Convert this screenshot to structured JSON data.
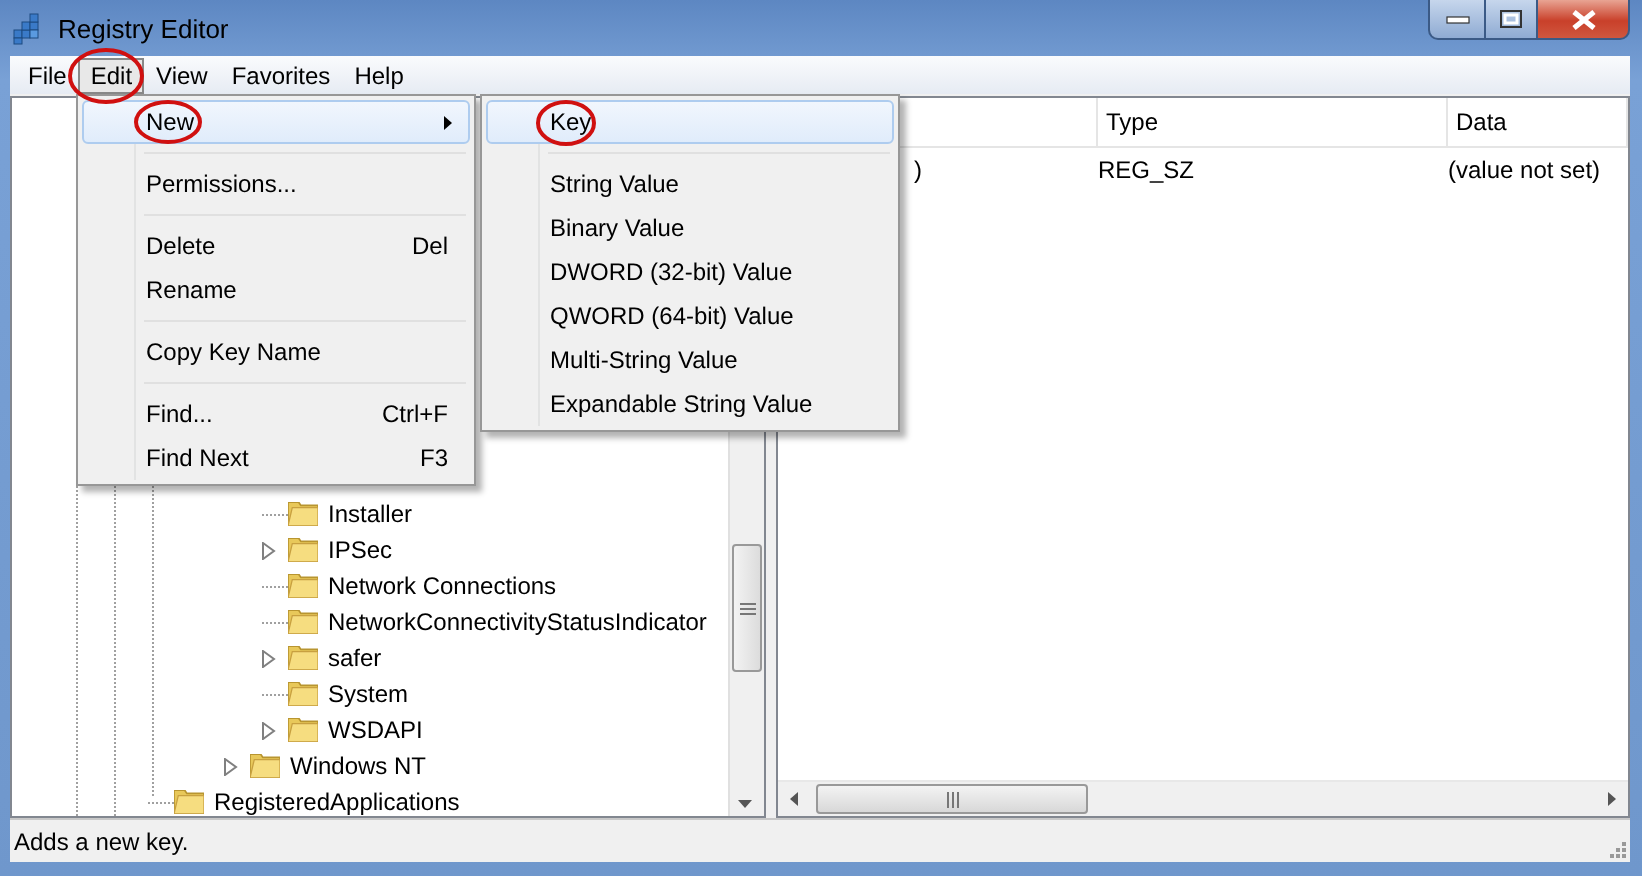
{
  "window": {
    "title": "Registry Editor"
  },
  "menu_bar": [
    {
      "label": "File",
      "selected": false,
      "circled": false
    },
    {
      "label": "Edit",
      "selected": true,
      "circled": true
    },
    {
      "label": "View",
      "selected": false,
      "circled": false
    },
    {
      "label": "Favorites",
      "selected": false,
      "circled": false
    },
    {
      "label": "Help",
      "selected": false,
      "circled": false
    }
  ],
  "edit_menu": [
    {
      "kind": "item",
      "label": "New",
      "submenu": true,
      "selected": true,
      "circled": true
    },
    {
      "kind": "separator"
    },
    {
      "kind": "item",
      "label": "Permissions...",
      "submenu": false,
      "selected": false,
      "circled": false
    },
    {
      "kind": "separator"
    },
    {
      "kind": "item",
      "label": "Delete",
      "shortcut": "Del",
      "submenu": false,
      "selected": false,
      "circled": false
    },
    {
      "kind": "item",
      "label": "Rename",
      "submenu": false,
      "selected": false,
      "circled": false
    },
    {
      "kind": "separator"
    },
    {
      "kind": "item",
      "label": "Copy Key Name",
      "submenu": false,
      "selected": false,
      "circled": false
    },
    {
      "kind": "separator"
    },
    {
      "kind": "item",
      "label": "Find...",
      "shortcut": "Ctrl+F",
      "submenu": false,
      "selected": false,
      "circled": false
    },
    {
      "kind": "item",
      "label": "Find Next",
      "shortcut": "F3",
      "submenu": false,
      "selected": false,
      "circled": false
    }
  ],
  "new_submenu": [
    {
      "kind": "item",
      "label": "Key",
      "selected": true,
      "circled": true
    },
    {
      "kind": "separator"
    },
    {
      "kind": "item",
      "label": "String Value",
      "selected": false,
      "circled": false
    },
    {
      "kind": "item",
      "label": "Binary Value",
      "selected": false,
      "circled": false
    },
    {
      "kind": "item",
      "label": "DWORD (32-bit) Value",
      "selected": false,
      "circled": false
    },
    {
      "kind": "item",
      "label": "QWORD (64-bit) Value",
      "selected": false,
      "circled": false
    },
    {
      "kind": "item",
      "label": "Multi-String Value",
      "selected": false,
      "circled": false
    },
    {
      "kind": "item",
      "label": "Expandable String Value",
      "selected": false,
      "circled": false
    }
  ],
  "tree": {
    "items": [
      {
        "children": [
          {
            "children": [
              {
                "children": [
                  {
                    "label": "Installer",
                    "expandable": false
                  },
                  {
                    "label": "IPSec",
                    "expandable": true
                  },
                  {
                    "label": "Network Connections",
                    "expandable": false
                  },
                  {
                    "label": "NetworkConnectivityStatusIndicator",
                    "expandable": false
                  },
                  {
                    "label": "safer",
                    "expandable": true
                  },
                  {
                    "label": "System",
                    "expandable": false
                  },
                  {
                    "label": "WSDAPI",
                    "expandable": true
                  }
                ]
              },
              {
                "label": "Windows NT",
                "expandable": true
              }
            ]
          }
        ]
      },
      {
        "label": "RegisteredApplications",
        "expandable": false
      }
    ]
  },
  "list": {
    "columns": [
      "Type",
      "Data"
    ],
    "rows": [
      {
        "column_1": ")",
        "type": "REG_SZ",
        "data": "(value not set)"
      }
    ]
  },
  "status_bar": "Adds a new key."
}
